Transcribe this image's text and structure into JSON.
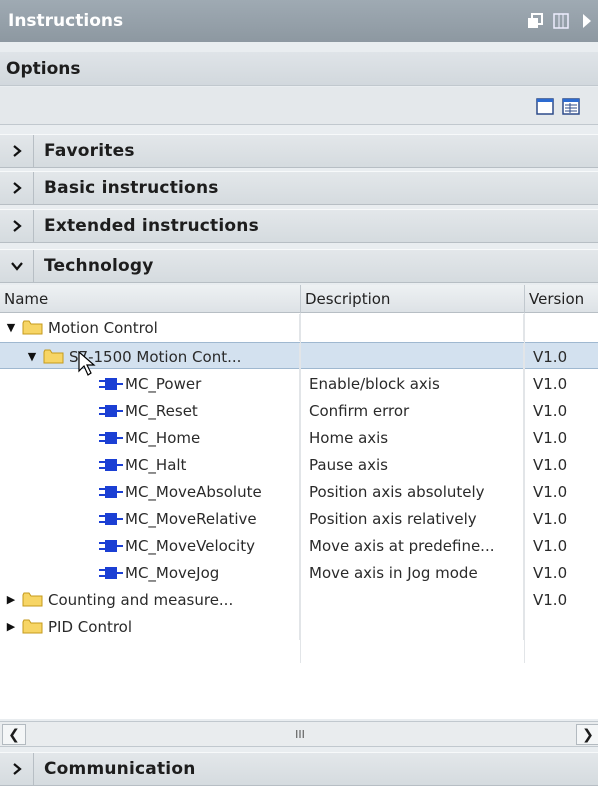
{
  "window": {
    "title": "Instructions"
  },
  "options": {
    "label": "Options"
  },
  "sections": {
    "favorites": "Favorites",
    "basic": "Basic instructions",
    "extended": "Extended instructions",
    "technology": "Technology",
    "communication": "Communication"
  },
  "table": {
    "columns": [
      "Name",
      "Description",
      "Version"
    ],
    "rows": [
      {
        "name": "Motion Control",
        "description": "",
        "version": ""
      },
      {
        "name": "S7-1500 Motion Cont...",
        "description": "",
        "version": "V1.0"
      },
      {
        "name": "MC_Power",
        "description": "Enable/block axis",
        "version": "V1.0"
      },
      {
        "name": "MC_Reset",
        "description": "Confirm error",
        "version": "V1.0"
      },
      {
        "name": "MC_Home",
        "description": "Home axis",
        "version": "V1.0"
      },
      {
        "name": "MC_Halt",
        "description": "Pause axis",
        "version": "V1.0"
      },
      {
        "name": "MC_MoveAbsolute",
        "description": "Position axis absolutely",
        "version": "V1.0"
      },
      {
        "name": "MC_MoveRelative",
        "description": "Position axis relatively",
        "version": "V1.0"
      },
      {
        "name": "MC_MoveVelocity",
        "description": "Move axis at predefine...",
        "version": "V1.0"
      },
      {
        "name": "MC_MoveJog",
        "description": "Move axis in Jog mode",
        "version": "V1.0"
      },
      {
        "name": "Counting and measure...",
        "description": "",
        "version": "V1.0"
      },
      {
        "name": "PID Control",
        "description": "",
        "version": ""
      }
    ]
  },
  "scrollbar": {
    "grip": "III"
  },
  "colors": {
    "selection": "#d3e1ef",
    "folder": "#f2c94c",
    "block": "#1b3fd4",
    "titlebar": "#96a1aa"
  }
}
